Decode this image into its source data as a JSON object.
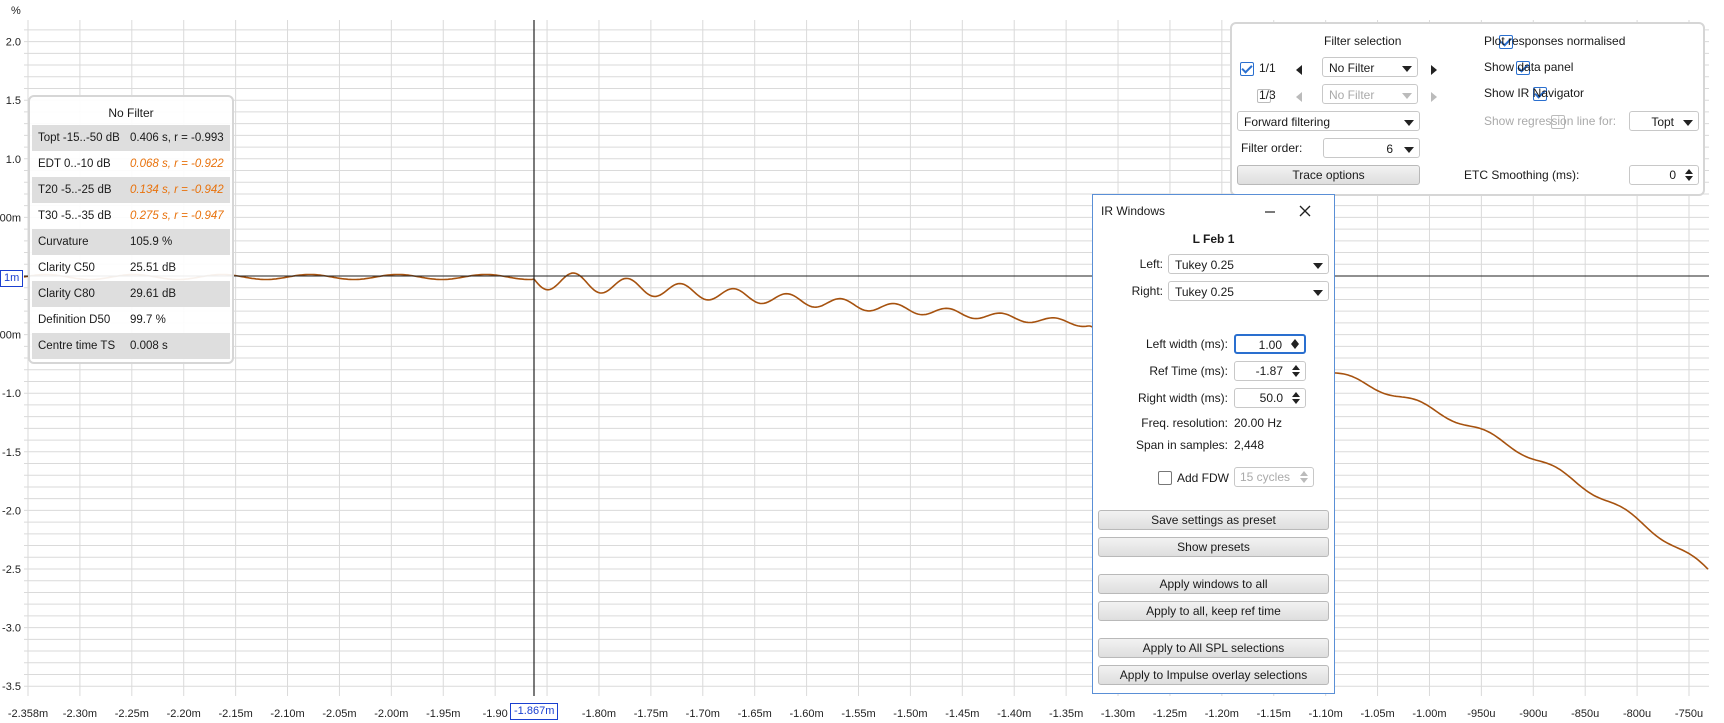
{
  "plot": {
    "y_unit": "%",
    "cursor_y_label": "1m",
    "cursor_x_label": "-1.867m",
    "y_ticks": [
      {
        "label": "2.0",
        "value": 2.0
      },
      {
        "label": "1.5",
        "value": 1.5
      },
      {
        "label": "1.0",
        "value": 1.0
      },
      {
        "label": "00m",
        "value": 0.5
      },
      {
        "label": "00m",
        "value": -0.5
      },
      {
        "label": "-1.0",
        "value": -1.0
      },
      {
        "label": "-1.5",
        "value": -1.5
      },
      {
        "label": "-2.0",
        "value": -2.0
      },
      {
        "label": "-2.5",
        "value": -2.5
      },
      {
        "label": "-3.0",
        "value": -3.0
      },
      {
        "label": "-3.5",
        "value": -3.5
      }
    ],
    "x_ticks": [
      "-2.358m",
      "-2.30m",
      "-2.25m",
      "-2.20m",
      "-2.15m",
      "-2.10m",
      "-2.05m",
      "-2.00m",
      "-1.95m",
      "-1.90",
      "m",
      "-1.80m",
      "-1.75m",
      "-1.70m",
      "-1.65m",
      "-1.60m",
      "-1.55m",
      "-1.50m",
      "-1.45m",
      "-1.40m",
      "-1.35m",
      "-1.30m",
      "-1.25m",
      "-1.20m",
      "-1.15m",
      "-1.10m",
      "-1.05m",
      "-1.00m",
      "-950u",
      "-900u",
      "-850u",
      "-800u",
      "-750u"
    ],
    "colors": {
      "trace": "#a6520f",
      "grid": "#dadada",
      "cursor": "#222222"
    }
  },
  "data_panel": {
    "title": "No Filter",
    "rows": [
      {
        "label": "Topt -15..-50 dB",
        "value": "0.406 s,  r = -0.993",
        "warn": false
      },
      {
        "label": "EDT  0..-10 dB",
        "value": "0.068 s,  r = -0.922",
        "warn": true
      },
      {
        "label": "T20 -5..-25 dB",
        "value": "0.134 s,  r = -0.942",
        "warn": true
      },
      {
        "label": "T30 -5..-35 dB",
        "value": "0.275 s,  r = -0.947",
        "warn": true
      },
      {
        "label": "Curvature",
        "value": "105.9 %",
        "warn": false
      },
      {
        "label": "Clarity C50",
        "value": "25.51 dB",
        "warn": false
      },
      {
        "label": "Clarity C80",
        "value": "29.61 dB",
        "warn": false
      },
      {
        "label": "Definition D50",
        "value": "99.7 %",
        "warn": false
      },
      {
        "label": "Centre time TS",
        "value": "0.008 s",
        "warn": false
      }
    ],
    "warn_color": "#e8720c"
  },
  "filter_panel": {
    "heading": "Filter selection",
    "oct1_label": "1/1",
    "oct3_label": "1/3",
    "filter1": "No Filter",
    "filter3": "No Filter",
    "filtering_mode": "Forward filtering",
    "filter_order_label": "Filter order:",
    "filter_order": "6",
    "trace_options": "Trace options",
    "plot_normalised": "Plot responses normalised",
    "show_data_panel": "Show data panel",
    "show_ir_navigator": "Show IR Navigator",
    "show_regression": "Show regression line for:",
    "regression_choice": "Topt",
    "etc_smoothing_label": "ETC Smoothing (ms):",
    "etc_smoothing": "0"
  },
  "ir_window": {
    "title": "IR Windows",
    "measurement": "L Feb 1",
    "left_label": "Left:",
    "left_window": "Tukey 0.25",
    "right_label": "Right:",
    "right_window": "Tukey 0.25",
    "left_width_label": "Left width (ms):",
    "left_width": "1.00",
    "ref_time_label": "Ref Time (ms):",
    "ref_time": "-1.87",
    "right_width_label": "Right width (ms):",
    "right_width": "50.0",
    "freq_res_label": "Freq. resolution:",
    "freq_res": "20.00 Hz",
    "span_label": "Span in samples:",
    "span": "2,448",
    "add_fdw_label": "Add FDW",
    "fdw_cycles": "15 cycles",
    "buttons": {
      "save_preset": "Save settings as preset",
      "show_presets": "Show presets",
      "apply_all": "Apply windows to all",
      "apply_keep": "Apply to all, keep ref time",
      "apply_spl": "Apply to All SPL selections",
      "apply_impulse": "Apply to Impulse overlay selections"
    }
  }
}
